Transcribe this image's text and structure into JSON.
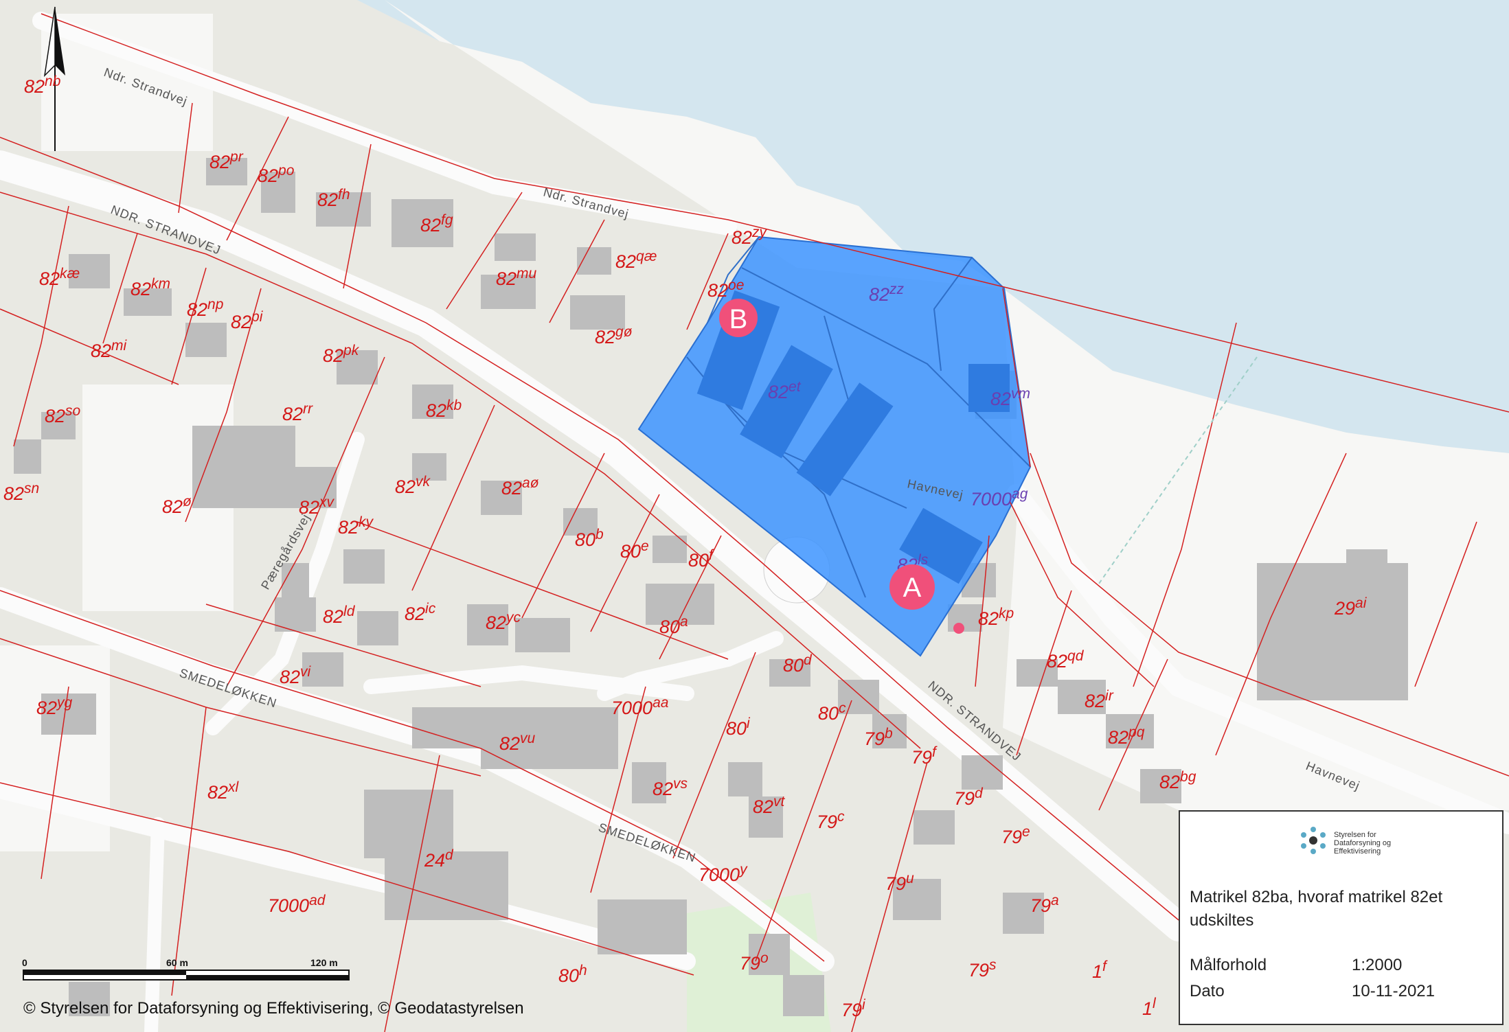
{
  "parcels": [
    {
      "num": "82",
      "sup": "nb"
    },
    {
      "num": "82",
      "sup": "pr"
    },
    {
      "num": "82",
      "sup": "po"
    },
    {
      "num": "82",
      "sup": "fh"
    },
    {
      "num": "82",
      "sup": "fg"
    },
    {
      "num": "82",
      "sup": "zy"
    },
    {
      "num": "82",
      "sup": "qæ"
    },
    {
      "num": "82",
      "sup": "mu"
    },
    {
      "num": "82",
      "sup": "oe"
    },
    {
      "num": "82",
      "sup": "gø"
    },
    {
      "num": "82",
      "sup": "kæ"
    },
    {
      "num": "82",
      "sup": "km"
    },
    {
      "num": "82",
      "sup": "np"
    },
    {
      "num": "82",
      "sup": "pi"
    },
    {
      "num": "82",
      "sup": "mi"
    },
    {
      "num": "82",
      "sup": "pk"
    },
    {
      "num": "82",
      "sup": "rr"
    },
    {
      "num": "82",
      "sup": "kb"
    },
    {
      "num": "82",
      "sup": "so"
    },
    {
      "num": "82",
      "sup": "sn"
    },
    {
      "num": "82",
      "sup": "ø"
    },
    {
      "num": "82",
      "sup": "xv"
    },
    {
      "num": "82",
      "sup": "vk"
    },
    {
      "num": "82",
      "sup": "aø"
    },
    {
      "num": "82",
      "sup": "ky"
    },
    {
      "num": "80",
      "sup": "b"
    },
    {
      "num": "80",
      "sup": "e"
    },
    {
      "num": "80",
      "sup": "f"
    },
    {
      "num": "82",
      "sup": "ld"
    },
    {
      "num": "82",
      "sup": "ic"
    },
    {
      "num": "82",
      "sup": "yc"
    },
    {
      "num": "80",
      "sup": "a"
    },
    {
      "num": "82",
      "sup": "vi"
    },
    {
      "num": "82",
      "sup": "yg"
    },
    {
      "num": "80",
      "sup": "d"
    },
    {
      "num": "7000",
      "sup": "aa"
    },
    {
      "num": "80",
      "sup": "c"
    },
    {
      "num": "82",
      "sup": "vu"
    },
    {
      "num": "80",
      "sup": "i"
    },
    {
      "num": "79",
      "sup": "b"
    },
    {
      "num": "79",
      "sup": "f"
    },
    {
      "num": "82",
      "sup": "xl"
    },
    {
      "num": "82",
      "sup": "vs"
    },
    {
      "num": "82",
      "sup": "vt"
    },
    {
      "num": "79",
      "sup": "d"
    },
    {
      "num": "79",
      "sup": "c"
    },
    {
      "num": "79",
      "sup": "e"
    },
    {
      "num": "24",
      "sup": "d"
    },
    {
      "num": "7000",
      "sup": "y"
    },
    {
      "num": "79",
      "sup": "u"
    },
    {
      "num": "7000",
      "sup": "ad"
    },
    {
      "num": "79",
      "sup": "a"
    },
    {
      "num": "79",
      "sup": "o"
    },
    {
      "num": "79",
      "sup": "s"
    },
    {
      "num": "1",
      "sup": "f"
    },
    {
      "num": "80",
      "sup": "h"
    },
    {
      "num": "79",
      "sup": "i"
    },
    {
      "num": "1",
      "sup": "l"
    },
    {
      "num": "82",
      "sup": "kp"
    },
    {
      "num": "82",
      "sup": "qd"
    },
    {
      "num": "82",
      "sup": "ir"
    },
    {
      "num": "82",
      "sup": "pq"
    },
    {
      "num": "82",
      "sup": "bg"
    },
    {
      "num": "29",
      "sup": "ai"
    }
  ],
  "highlight_parcels": [
    {
      "num": "82",
      "sup": "zz"
    },
    {
      "num": "82",
      "sup": "et"
    },
    {
      "num": "82",
      "sup": "vm"
    },
    {
      "num": "7000",
      "sup": "ag"
    },
    {
      "num": "82",
      "sup": "ls"
    }
  ],
  "roads": {
    "strandvej_1": "Ndr. Strandvej",
    "strandvej_2": "Ndr. Strandvej",
    "strandvej_3": "NDR. STRANDVEJ",
    "strandvej_4": "NDR. STRANDVEJ",
    "havnevej_1": "Havnevej",
    "havnevej_2": "Havnevej",
    "paeregaardsvej": "Pæregårdsvej",
    "smedeloekken_1": "SMEDELØKKEN",
    "smedeloekken_2": "SMEDELØKKEN"
  },
  "markers": {
    "a": "A",
    "b": "B"
  },
  "scale_bar": {
    "t0": "0",
    "t1": "60 m",
    "t2": "120 m"
  },
  "info": {
    "logo_text": "Styrelsen for Dataforsyning og Effektivisering",
    "title": "Matrikel 82ba, hvoraf matrikel 82et udskiltes",
    "scale_label": "Målforhold",
    "scale_value": "1:2000",
    "date_label": "Dato",
    "date_value": "10-11-2021"
  },
  "copyright": "© Styrelsen for Dataforsyning og Effektivisering, © Geodatastyrelsen",
  "colors": {
    "water": "#d4e6ef",
    "land": "#e9e9e3",
    "building": "#bdbdbd",
    "parcel_line": "#d42020",
    "highlight": "#3d94ff",
    "marker": "#f0507a"
  }
}
